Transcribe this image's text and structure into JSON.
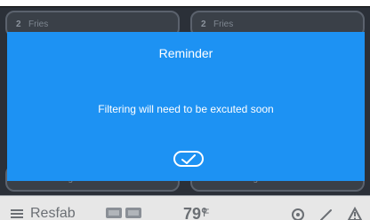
{
  "modal": {
    "title": "Reminder",
    "message": "Filtering will need to be excuted soon",
    "confirm_icon": "check-icon"
  },
  "background_tiles": [
    {
      "num": "2",
      "name": "Fries"
    },
    {
      "num": "2",
      "name": "Fries"
    },
    {
      "num": "6",
      "name": "Onion Rings"
    },
    {
      "num": "6",
      "name": "Onion Rings"
    }
  ],
  "bottom_bar": {
    "menu_label": "Resfab",
    "temperature": "79°",
    "temperature_unit": "F",
    "icons": [
      "vat-icon",
      "settings-icon",
      "maintenance-icon",
      "alert-icon"
    ]
  },
  "colors": {
    "modal_bg": "#1d92f3",
    "screen_bg": "#2b3038",
    "bottom_bar_bg": "#e7e7e7"
  }
}
